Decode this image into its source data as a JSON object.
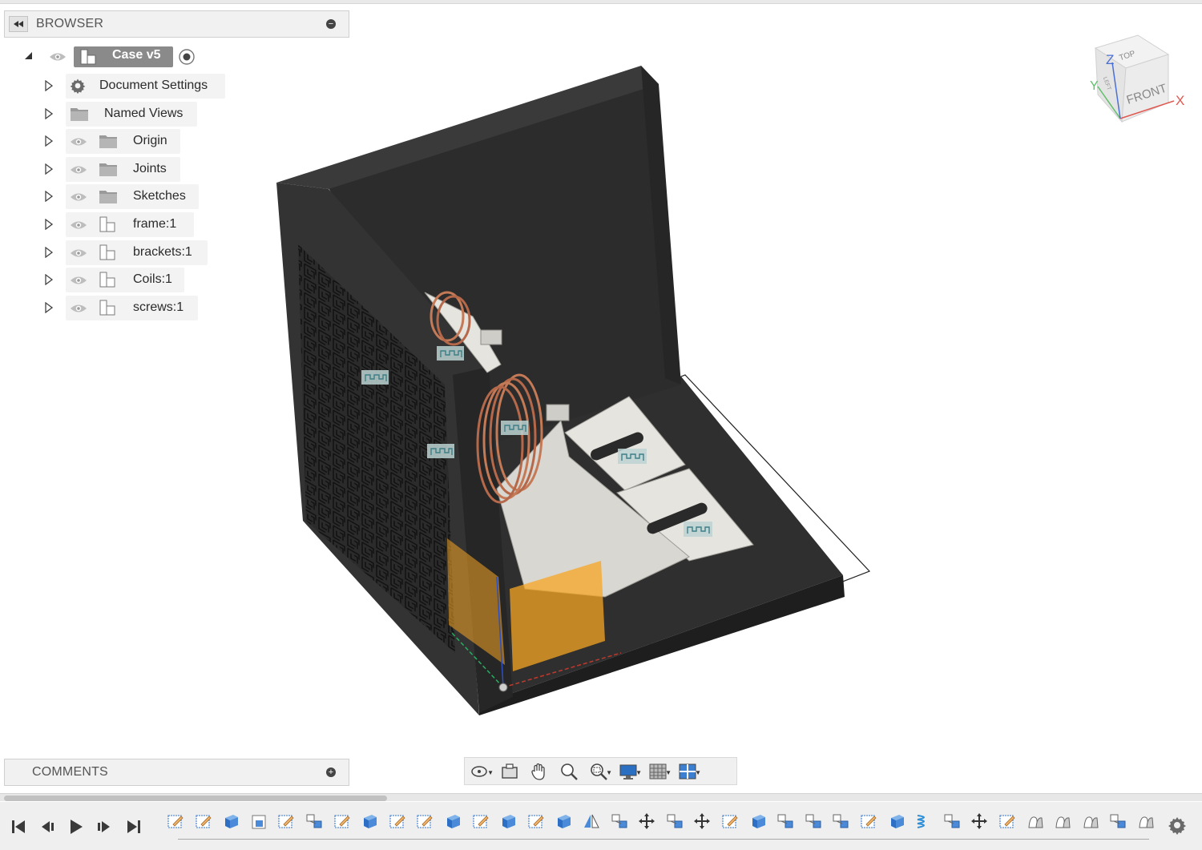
{
  "browser": {
    "title": "BROWSER",
    "root": {
      "label": "Case v5"
    },
    "items": [
      {
        "label": "Document Settings",
        "icon": "gear-icon",
        "visible": false
      },
      {
        "label": "Named Views",
        "icon": "folder-icon",
        "visible": false
      },
      {
        "label": "Origin",
        "icon": "folder-icon",
        "visible": true
      },
      {
        "label": "Joints",
        "icon": "folder-icon",
        "visible": true
      },
      {
        "label": "Sketches",
        "icon": "folder-icon",
        "visible": true
      },
      {
        "label": "frame:1",
        "icon": "component-icon",
        "visible": true
      },
      {
        "label": "brackets:1",
        "icon": "component-icon",
        "visible": true
      },
      {
        "label": "Coils:1",
        "icon": "component-icon",
        "visible": true
      },
      {
        "label": "screws:1",
        "icon": "component-icon",
        "visible": true
      }
    ]
  },
  "comments": {
    "title": "COMMENTS"
  },
  "viewcube": {
    "top": "TOP",
    "front": "FRONT",
    "left": "LEFT",
    "axis_x": "X",
    "axis_y": "Y",
    "axis_z": "Z"
  },
  "colors": {
    "model_dark": "#2e2e2e",
    "bracket": "#e4e2dc",
    "coil": "#c47a56",
    "origin_plane": "#f5a623",
    "selection_outline": "#1c1c1c"
  },
  "nav_tools": [
    "orbit-tool",
    "look-at-tool",
    "pan-tool",
    "zoom-tool",
    "fit-tool",
    "display-settings-tool",
    "grid-settings-tool",
    "viewports-tool"
  ],
  "timeline": {
    "controls": [
      "skip-to-start",
      "step-back",
      "play",
      "step-forward",
      "skip-to-end"
    ]
  }
}
